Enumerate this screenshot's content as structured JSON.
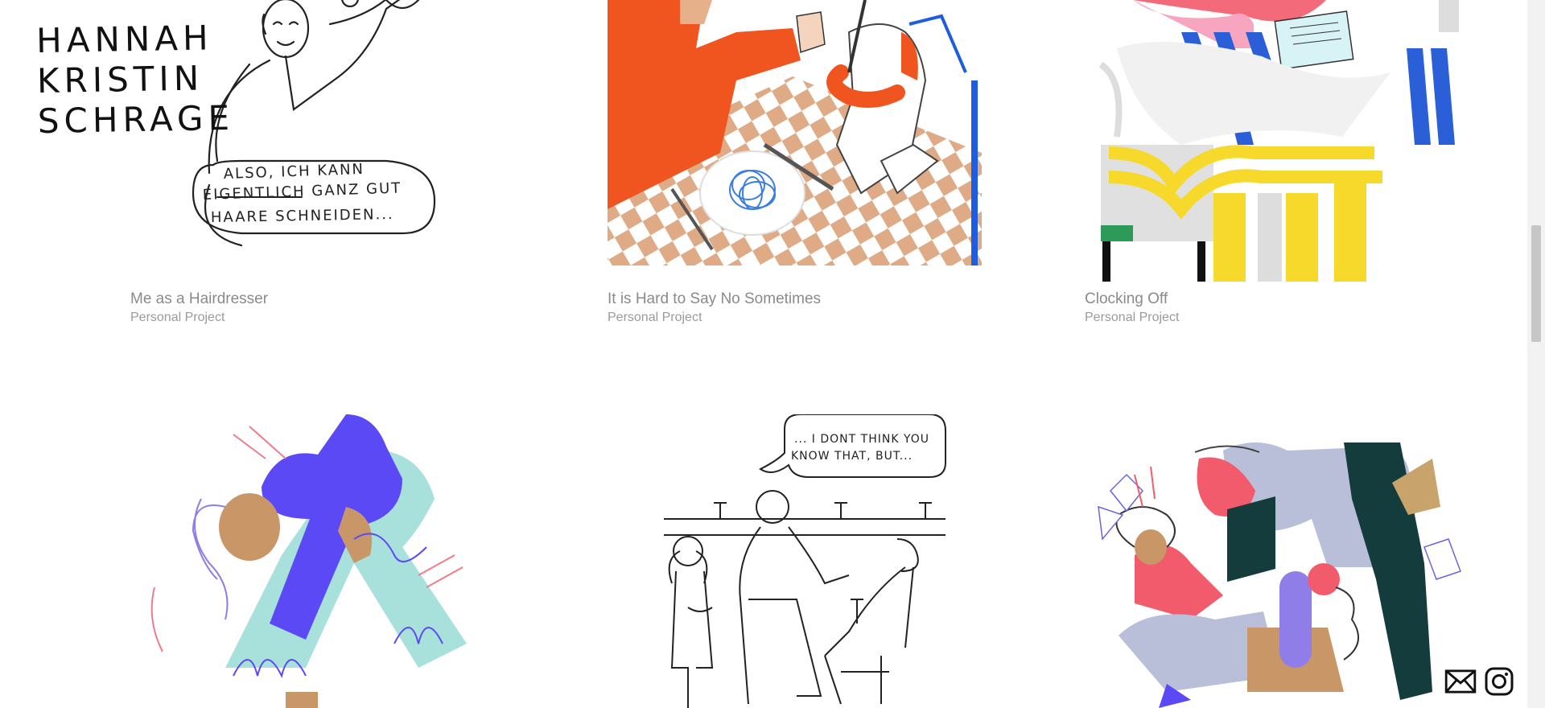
{
  "logo": {
    "lines": [
      "HANNAH",
      "KRISTIN",
      "SCHRAGE"
    ]
  },
  "projects": [
    {
      "title": "Me as a Hairdresser",
      "subtitle": "Personal Project",
      "speech": [
        "ALSO, ICH KANN",
        "EIGENTLICH GANZ GUT",
        "HAARE SCHNEIDEN..."
      ]
    },
    {
      "title": "It is Hard to Say No Sometimes",
      "subtitle": "Personal Project"
    },
    {
      "title": "Clocking Off",
      "subtitle": "Personal Project"
    },
    {
      "title": "",
      "subtitle": ""
    },
    {
      "title": "",
      "subtitle": "",
      "speech": [
        "... I DONT THINK YOU",
        "KNOW THAT, BUT..."
      ]
    },
    {
      "title": "",
      "subtitle": ""
    }
  ],
  "social": [
    {
      "icon": "mail-icon"
    },
    {
      "icon": "instagram-icon"
    }
  ],
  "colors": {
    "caption_text": "#8a8a8a",
    "orange": "#f1551f",
    "tan": "#deab86",
    "blue": "#5b49f5",
    "mint": "#a8e0dc",
    "yellow": "#f6d92b",
    "pink": "#f25b6c",
    "green": "#2d9a5a",
    "dark_teal": "#143c3c"
  }
}
